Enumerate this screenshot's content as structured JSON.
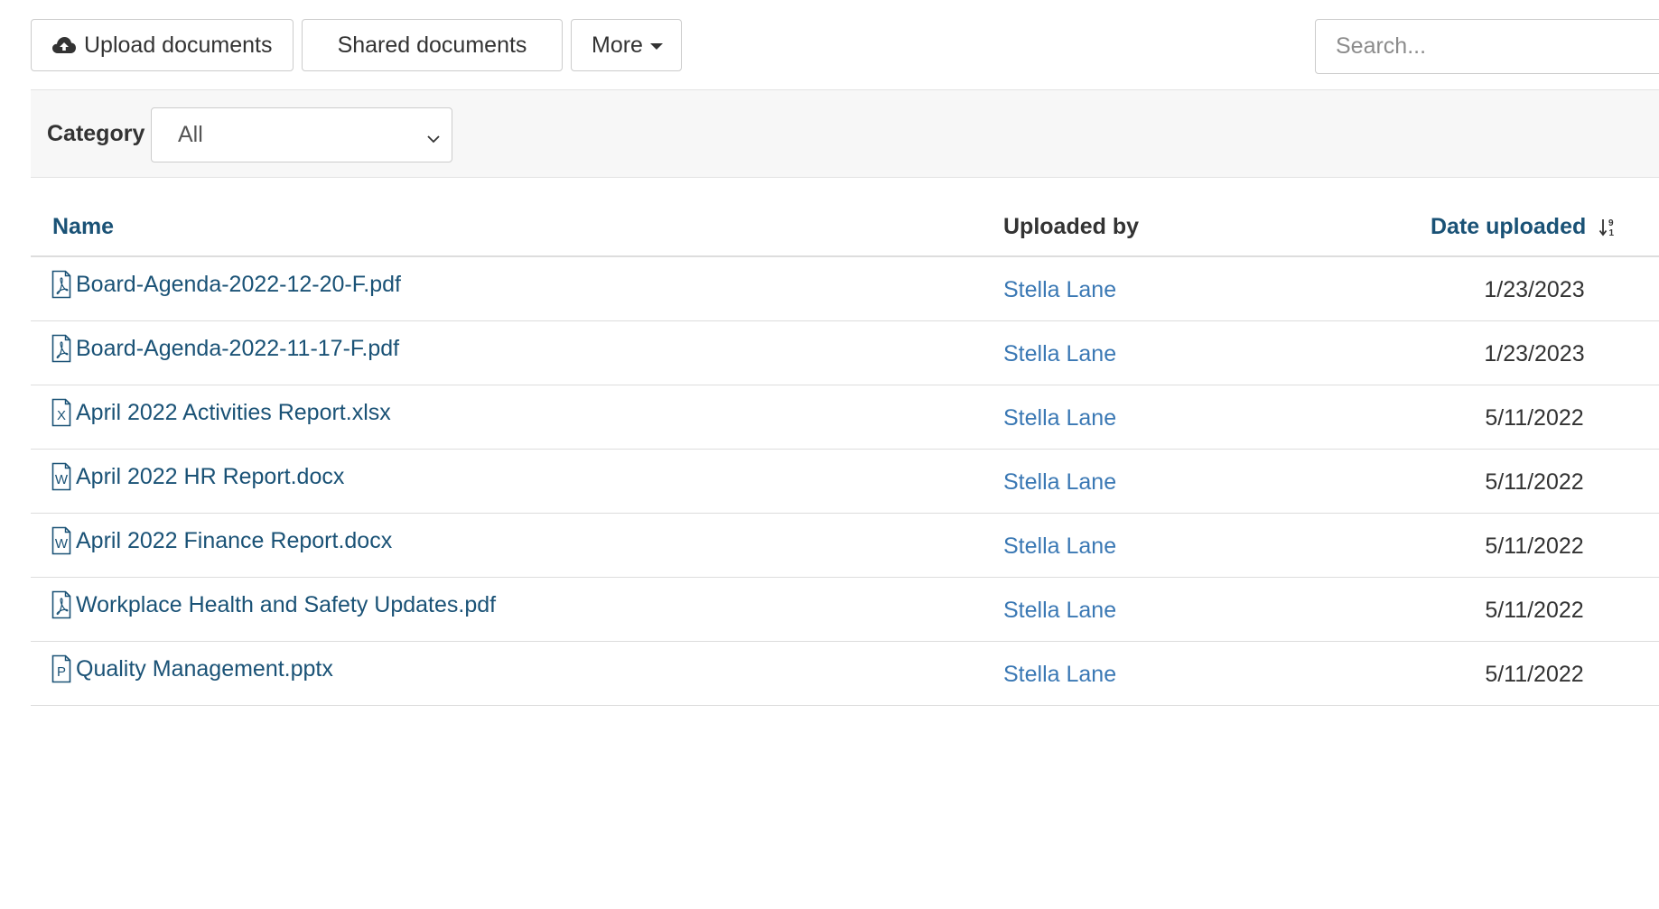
{
  "toolbar": {
    "upload_label": "Upload documents",
    "upload_icon": "cloud-upload-icon",
    "shared_label": "Shared documents",
    "more_label": "More"
  },
  "search": {
    "placeholder": "Search..."
  },
  "filter": {
    "label": "Category",
    "selected": "All"
  },
  "table": {
    "columns": {
      "name": "Name",
      "uploaded_by": "Uploaded by",
      "date_uploaded": "Date uploaded"
    },
    "rows": [
      {
        "name": "Board-Agenda-2022-12-20-F.pdf",
        "type": "pdf",
        "uploaded_by": "Stella Lane",
        "date": "1/23/2023"
      },
      {
        "name": "Board-Agenda-2022-11-17-F.pdf",
        "type": "pdf",
        "uploaded_by": "Stella Lane",
        "date": "1/23/2023"
      },
      {
        "name": "April 2022 Activities Report.xlsx",
        "type": "xlsx",
        "uploaded_by": "Stella Lane",
        "date": "5/11/2022"
      },
      {
        "name": "April 2022 HR Report.docx",
        "type": "docx",
        "uploaded_by": "Stella Lane",
        "date": "5/11/2022"
      },
      {
        "name": "April 2022 Finance Report.docx",
        "type": "docx",
        "uploaded_by": "Stella Lane",
        "date": "5/11/2022"
      },
      {
        "name": "Workplace Health and Safety Updates.pdf",
        "type": "pdf",
        "uploaded_by": "Stella Lane",
        "date": "5/11/2022"
      },
      {
        "name": "Quality Management.pptx",
        "type": "pptx",
        "uploaded_by": "Stella Lane",
        "date": "5/11/2022"
      }
    ]
  },
  "colors": {
    "link": "#1a5276",
    "user_link": "#3a78b4",
    "filter_bg": "#f7f7f7"
  }
}
